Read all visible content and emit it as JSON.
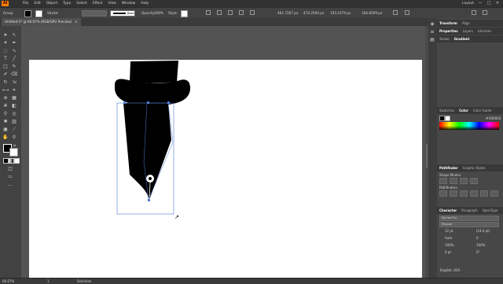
{
  "app": {
    "logo": "Ai"
  },
  "menu": [
    "File",
    "Edit",
    "Object",
    "Type",
    "Select",
    "Effect",
    "View",
    "Window",
    "Help"
  ],
  "menubar_right": {
    "workspace": "Layout",
    "min": "—",
    "max": "□",
    "close": "✕"
  },
  "control_bar": {
    "selection": "Group",
    "stroke_label": "Stroke:",
    "brush_label": "Basic",
    "opacity_label": "Opacity:",
    "opacity_value": "100%",
    "style_label": "Style:",
    "x_value": "461.7267 px",
    "y_value": "474.2594 px",
    "w_value": "193.2379 px",
    "h_value": "166.8299 px"
  },
  "document_tab": {
    "title": "Untitled-1* @ 66.67% (RGB/GPU Preview)",
    "close": "×"
  },
  "panels": {
    "top_tabs_1": [
      "Properties",
      "Layers",
      "Libraries"
    ],
    "top_tabs_1b": [
      "Transform",
      "Align"
    ],
    "top_tabs_2": [
      "Stroke",
      "Gradient"
    ],
    "color_tabs": [
      "Swatches",
      "Color",
      "Color Guide"
    ],
    "color_hex": "000000",
    "pathfinder_tabs": [
      "Pathfinder",
      "Graphic Styles"
    ],
    "shape_modes_label": "Shape Modes:",
    "pathfinders_label": "Pathfinders:",
    "character_tabs": [
      "Character",
      "Paragraph",
      "OpenType"
    ],
    "font_name": "Myriad Pro",
    "font_style": "Regular",
    "font_size": "12 pt",
    "leading": "(14.4 pt)",
    "kerning": "Auto",
    "tracking": "0",
    "hscale": "100%",
    "vscale": "100%",
    "baseline": "0 pt",
    "rotation": "0°",
    "language": "English: USA"
  },
  "status": {
    "zoom": "66.67%",
    "artboard": "1",
    "tool": "Selection"
  },
  "colors": {
    "fill": "#000000",
    "stroke": "#ffffff",
    "accent": "#ff7c00",
    "selection": "#4f7dd1"
  }
}
